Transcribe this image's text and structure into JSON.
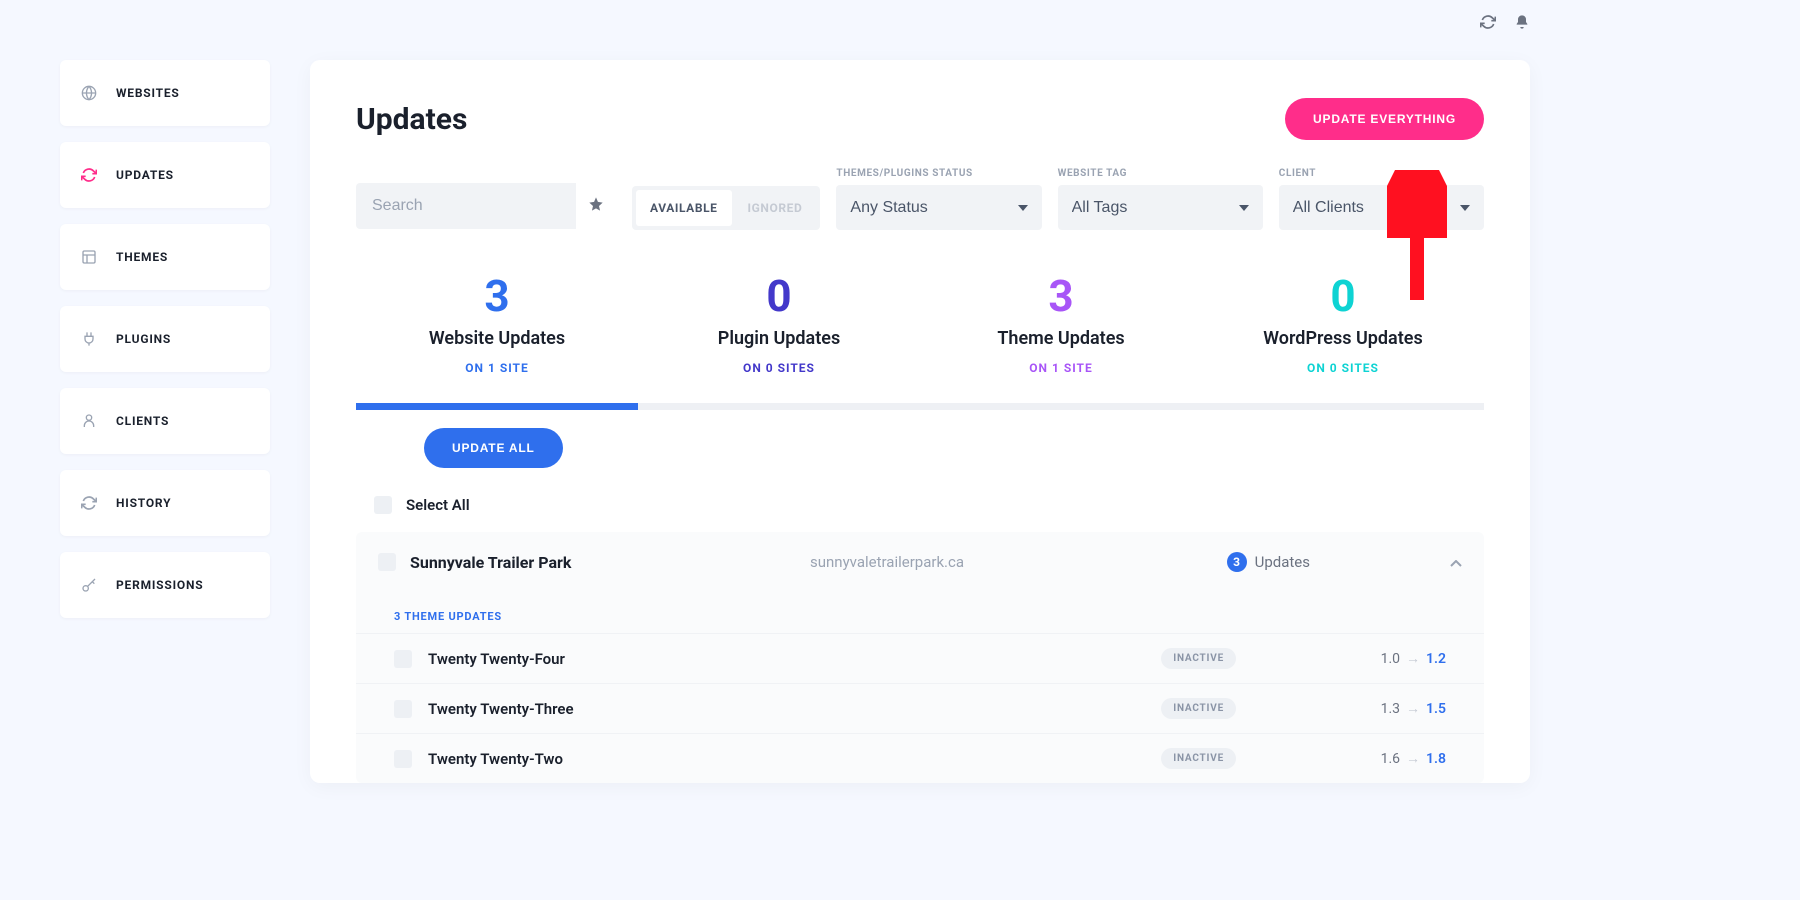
{
  "sidebar": {
    "items": [
      {
        "label": "WEBSITES",
        "icon": "globe"
      },
      {
        "label": "UPDATES",
        "icon": "refresh",
        "active": true
      },
      {
        "label": "THEMES",
        "icon": "layout"
      },
      {
        "label": "PLUGINS",
        "icon": "plug"
      },
      {
        "label": "CLIENTS",
        "icon": "user"
      },
      {
        "label": "HISTORY",
        "icon": "history"
      },
      {
        "label": "PERMISSIONS",
        "icon": "key"
      }
    ]
  },
  "header": {
    "title": "Updates",
    "update_everything": "UPDATE EVERYTHING"
  },
  "filters": {
    "search_placeholder": "Search",
    "tab_available": "AVAILABLE",
    "tab_ignored": "IGNORED",
    "status_label": "THEMES/PLUGINS STATUS",
    "status_value": "Any Status",
    "tag_label": "WEBSITE TAG",
    "tag_value": "All Tags",
    "client_label": "CLIENT",
    "client_value": "All Clients"
  },
  "stats": [
    {
      "num": "3",
      "label": "Website Updates",
      "sub": "ON 1 SITE",
      "cls": "c-blue",
      "active": true
    },
    {
      "num": "0",
      "label": "Plugin Updates",
      "sub": "ON 0 SITES",
      "cls": "c-indigo"
    },
    {
      "num": "3",
      "label": "Theme Updates",
      "sub": "ON 1 SITE",
      "cls": "c-purple"
    },
    {
      "num": "0",
      "label": "WordPress Updates",
      "sub": "ON 0 SITES",
      "cls": "c-teal"
    }
  ],
  "actions": {
    "update_all": "UPDATE ALL",
    "select_all": "Select All"
  },
  "site": {
    "name": "Sunnyvale Trailer Park",
    "url": "sunnyvaletrailerpark.ca",
    "updates_count": "3",
    "updates_label": "Updates",
    "section_header": "3 THEME UPDATES",
    "themes": [
      {
        "name": "Twenty Twenty-Four",
        "status": "INACTIVE",
        "from": "1.0",
        "to": "1.2"
      },
      {
        "name": "Twenty Twenty-Three",
        "status": "INACTIVE",
        "from": "1.3",
        "to": "1.5"
      },
      {
        "name": "Twenty Twenty-Two",
        "status": "INACTIVE",
        "from": "1.6",
        "to": "1.8"
      }
    ]
  }
}
